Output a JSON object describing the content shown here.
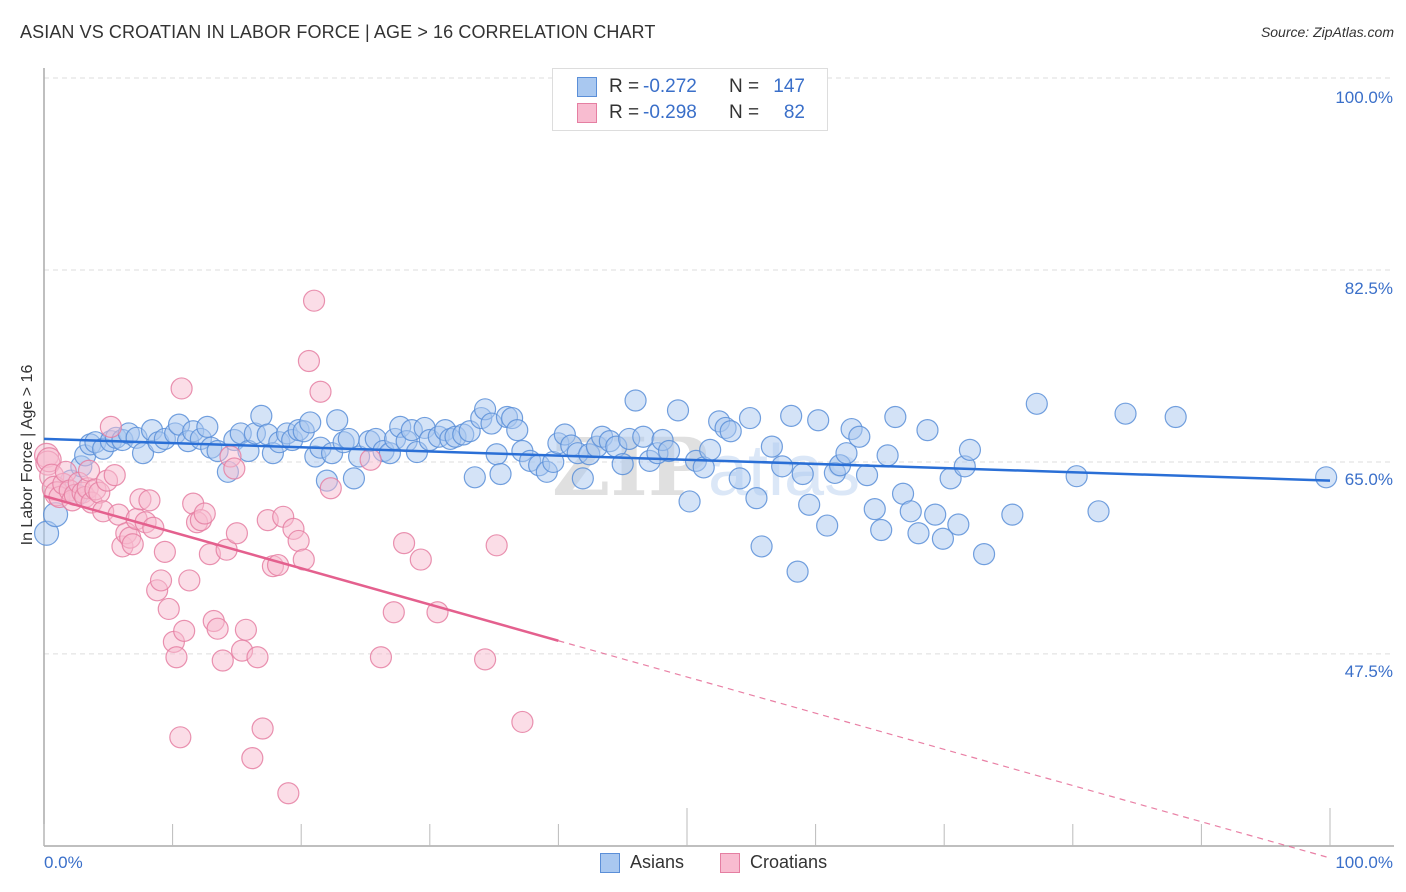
{
  "title": "ASIAN VS CROATIAN IN LABOR FORCE | AGE > 16 CORRELATION CHART",
  "source": "Source: ZipAtlas.com",
  "watermark": "ZIPatlas",
  "colors": {
    "asians_fill": "#a9c8f0",
    "asians_stroke": "#5b8fd8",
    "asians_line": "#2a6fd6",
    "croatians_fill": "#f8bcd0",
    "croatians_stroke": "#e57fa2",
    "croatians_line": "#e4608e",
    "tick_label": "#3a6fc9",
    "grid": "#dddddd"
  },
  "legend": {
    "rows": [
      {
        "series": "Asians",
        "r_label": "R =",
        "r_value": "-0.272",
        "n_label": "N =",
        "n_value": "147"
      },
      {
        "series": "Croatians",
        "r_label": "R =",
        "r_value": "-0.298",
        "n_label": "N =",
        "n_value": "82"
      }
    ]
  },
  "bottom_legend": [
    "Asians",
    "Croatians"
  ],
  "chart_data": {
    "type": "scatter",
    "title": "ASIAN VS CROATIAN IN LABOR FORCE | AGE > 16 CORRELATION CHART",
    "xlabel": "",
    "ylabel": "In Labor Force | Age > 16",
    "xlim": [
      0,
      100
    ],
    "ylim": [
      30.9,
      101.6
    ],
    "x_tick_labels": [
      "0.0%",
      "100.0%"
    ],
    "y_ticks": [
      100.0,
      82.5,
      65.0,
      47.5
    ],
    "y_tick_labels": [
      "100.0%",
      "82.5%",
      "65.0%",
      "47.5%"
    ],
    "grid": true,
    "legend_position": "top-center",
    "series": [
      {
        "name": "Asians",
        "r": -0.272,
        "n": 147,
        "trend": {
          "x": [
            0,
            100
          ],
          "y": [
            67.1,
            63.3
          ],
          "style": "solid"
        },
        "points": [
          [
            0.2,
            58.5
          ],
          [
            0.9,
            60.2
          ],
          [
            2.1,
            63.3
          ],
          [
            2.6,
            62.0
          ],
          [
            2.9,
            64.6
          ],
          [
            3.2,
            65.6
          ],
          [
            3.6,
            66.6
          ],
          [
            4.0,
            66.8
          ],
          [
            4.6,
            66.2
          ],
          [
            5.2,
            66.9
          ],
          [
            5.6,
            67.2
          ],
          [
            6.1,
            67.0
          ],
          [
            6.6,
            67.6
          ],
          [
            7.2,
            67.2
          ],
          [
            7.7,
            65.8
          ],
          [
            8.4,
            67.9
          ],
          [
            8.9,
            66.8
          ],
          [
            9.4,
            67.1
          ],
          [
            10.2,
            67.6
          ],
          [
            10.5,
            68.4
          ],
          [
            11.2,
            66.9
          ],
          [
            11.6,
            67.8
          ],
          [
            12.2,
            67.1
          ],
          [
            12.7,
            68.2
          ],
          [
            13.0,
            66.3
          ],
          [
            13.5,
            66.0
          ],
          [
            14.3,
            64.1
          ],
          [
            14.8,
            67.0
          ],
          [
            15.3,
            67.6
          ],
          [
            15.9,
            66.0
          ],
          [
            16.4,
            67.6
          ],
          [
            16.9,
            69.2
          ],
          [
            17.4,
            67.5
          ],
          [
            17.8,
            65.8
          ],
          [
            18.3,
            66.8
          ],
          [
            18.9,
            67.6
          ],
          [
            19.3,
            67.0
          ],
          [
            19.8,
            67.9
          ],
          [
            20.2,
            67.8
          ],
          [
            20.7,
            68.6
          ],
          [
            21.1,
            65.5
          ],
          [
            21.5,
            66.3
          ],
          [
            22.0,
            63.3
          ],
          [
            22.4,
            65.8
          ],
          [
            22.8,
            68.8
          ],
          [
            23.3,
            66.8
          ],
          [
            23.7,
            67.1
          ],
          [
            24.1,
            63.5
          ],
          [
            24.5,
            65.5
          ],
          [
            25.3,
            66.9
          ],
          [
            25.8,
            67.1
          ],
          [
            26.4,
            66.0
          ],
          [
            26.9,
            65.8
          ],
          [
            27.3,
            67.1
          ],
          [
            27.7,
            68.2
          ],
          [
            28.2,
            66.9
          ],
          [
            28.6,
            67.9
          ],
          [
            29.0,
            65.9
          ],
          [
            29.6,
            68.1
          ],
          [
            30.0,
            67.0
          ],
          [
            30.7,
            67.3
          ],
          [
            31.2,
            67.9
          ],
          [
            31.6,
            67.1
          ],
          [
            32.0,
            67.3
          ],
          [
            32.6,
            67.5
          ],
          [
            33.1,
            67.8
          ],
          [
            33.5,
            63.6
          ],
          [
            34.0,
            69.0
          ],
          [
            34.3,
            69.8
          ],
          [
            34.8,
            68.5
          ],
          [
            35.2,
            65.7
          ],
          [
            35.5,
            63.9
          ],
          [
            36.0,
            69.1
          ],
          [
            36.4,
            69.0
          ],
          [
            36.8,
            67.9
          ],
          [
            37.2,
            66.0
          ],
          [
            37.8,
            65.1
          ],
          [
            38.5,
            64.7
          ],
          [
            39.1,
            64.1
          ],
          [
            39.6,
            65.0
          ],
          [
            40.0,
            66.7
          ],
          [
            40.5,
            67.5
          ],
          [
            41.0,
            66.5
          ],
          [
            41.5,
            65.8
          ],
          [
            41.9,
            63.5
          ],
          [
            42.4,
            65.7
          ],
          [
            43.0,
            66.4
          ],
          [
            43.4,
            67.3
          ],
          [
            44.0,
            66.9
          ],
          [
            44.5,
            66.4
          ],
          [
            45.0,
            64.8
          ],
          [
            45.5,
            67.1
          ],
          [
            46.0,
            70.6
          ],
          [
            46.6,
            67.3
          ],
          [
            47.1,
            65.1
          ],
          [
            47.7,
            65.8
          ],
          [
            48.1,
            67.0
          ],
          [
            48.6,
            66.0
          ],
          [
            49.3,
            69.7
          ],
          [
            50.2,
            61.4
          ],
          [
            50.7,
            65.1
          ],
          [
            51.3,
            64.5
          ],
          [
            51.8,
            66.1
          ],
          [
            52.5,
            68.7
          ],
          [
            53.0,
            68.1
          ],
          [
            53.4,
            67.8
          ],
          [
            54.1,
            63.5
          ],
          [
            54.9,
            69.0
          ],
          [
            55.4,
            61.7
          ],
          [
            55.8,
            57.3
          ],
          [
            56.6,
            66.4
          ],
          [
            57.4,
            64.6
          ],
          [
            58.1,
            69.2
          ],
          [
            58.6,
            55.0
          ],
          [
            59.0,
            63.9
          ],
          [
            59.5,
            61.1
          ],
          [
            60.2,
            68.8
          ],
          [
            60.9,
            59.2
          ],
          [
            61.5,
            64.0
          ],
          [
            61.9,
            64.7
          ],
          [
            62.4,
            65.8
          ],
          [
            62.8,
            68.0
          ],
          [
            63.4,
            67.3
          ],
          [
            64.0,
            63.8
          ],
          [
            64.6,
            60.7
          ],
          [
            65.1,
            58.8
          ],
          [
            65.6,
            65.6
          ],
          [
            66.2,
            69.1
          ],
          [
            66.8,
            62.1
          ],
          [
            67.4,
            60.5
          ],
          [
            68.0,
            58.5
          ],
          [
            68.7,
            67.9
          ],
          [
            69.3,
            60.2
          ],
          [
            69.9,
            58.0
          ],
          [
            70.5,
            63.5
          ],
          [
            71.1,
            59.3
          ],
          [
            71.6,
            64.6
          ],
          [
            72.0,
            66.1
          ],
          [
            73.1,
            56.6
          ],
          [
            75.3,
            60.2
          ],
          [
            77.2,
            70.3
          ],
          [
            80.3,
            63.7
          ],
          [
            82.0,
            60.5
          ],
          [
            84.1,
            69.4
          ],
          [
            88.0,
            69.1
          ],
          [
            99.7,
            63.6
          ]
        ]
      },
      {
        "name": "Croatians",
        "r": -0.298,
        "n": 82,
        "trend": {
          "x": [
            0,
            40,
            100
          ],
          "y": [
            61.9,
            48.7,
            28.9
          ],
          "style": "solid-then-dashed",
          "solid_until_x": 40
        },
        "points": [
          [
            0.2,
            65.6
          ],
          [
            0.3,
            64.9
          ],
          [
            0.4,
            65.2
          ],
          [
            0.6,
            63.7
          ],
          [
            0.8,
            62.6
          ],
          [
            1.0,
            62.1
          ],
          [
            1.2,
            61.8
          ],
          [
            1.5,
            63.0
          ],
          [
            1.7,
            64.1
          ],
          [
            2.0,
            62.4
          ],
          [
            2.2,
            61.5
          ],
          [
            2.4,
            62.0
          ],
          [
            2.7,
            63.1
          ],
          [
            3.0,
            62.2
          ],
          [
            3.2,
            61.8
          ],
          [
            3.4,
            62.6
          ],
          [
            3.5,
            64.2
          ],
          [
            3.7,
            61.3
          ],
          [
            4.0,
            62.5
          ],
          [
            4.3,
            62.2
          ],
          [
            4.6,
            60.5
          ],
          [
            4.9,
            63.3
          ],
          [
            5.2,
            68.2
          ],
          [
            5.5,
            63.8
          ],
          [
            5.8,
            60.2
          ],
          [
            6.1,
            57.3
          ],
          [
            6.4,
            58.5
          ],
          [
            6.7,
            58.1
          ],
          [
            6.9,
            57.5
          ],
          [
            7.2,
            59.8
          ],
          [
            7.5,
            61.6
          ],
          [
            7.9,
            59.5
          ],
          [
            8.2,
            61.5
          ],
          [
            8.5,
            59.0
          ],
          [
            8.8,
            53.3
          ],
          [
            9.1,
            54.2
          ],
          [
            9.4,
            56.8
          ],
          [
            9.7,
            51.6
          ],
          [
            10.1,
            48.6
          ],
          [
            10.3,
            47.2
          ],
          [
            10.6,
            39.9
          ],
          [
            10.9,
            49.6
          ],
          [
            11.3,
            54.2
          ],
          [
            11.6,
            61.2
          ],
          [
            11.9,
            59.5
          ],
          [
            12.2,
            59.7
          ],
          [
            12.5,
            60.3
          ],
          [
            12.9,
            56.6
          ],
          [
            13.2,
            50.5
          ],
          [
            13.5,
            49.8
          ],
          [
            13.9,
            46.9
          ],
          [
            14.2,
            57.0
          ],
          [
            14.5,
            65.5
          ],
          [
            14.8,
            64.4
          ],
          [
            15.0,
            58.5
          ],
          [
            15.4,
            47.8
          ],
          [
            15.7,
            49.7
          ],
          [
            16.2,
            38.0
          ],
          [
            16.6,
            47.2
          ],
          [
            17.0,
            40.7
          ],
          [
            17.4,
            59.7
          ],
          [
            17.8,
            55.5
          ],
          [
            18.2,
            55.6
          ],
          [
            18.6,
            60.0
          ],
          [
            19.0,
            34.8
          ],
          [
            19.4,
            58.9
          ],
          [
            19.8,
            57.8
          ],
          [
            20.2,
            56.1
          ],
          [
            20.6,
            74.2
          ],
          [
            21.0,
            79.7
          ],
          [
            21.5,
            71.4
          ],
          [
            22.3,
            62.6
          ],
          [
            25.4,
            65.2
          ],
          [
            26.2,
            47.2
          ],
          [
            27.2,
            51.3
          ],
          [
            28.0,
            57.6
          ],
          [
            29.3,
            56.1
          ],
          [
            30.6,
            51.3
          ],
          [
            34.3,
            47.0
          ],
          [
            35.2,
            57.4
          ],
          [
            37.2,
            41.3
          ],
          [
            10.7,
            71.7
          ]
        ]
      }
    ]
  }
}
